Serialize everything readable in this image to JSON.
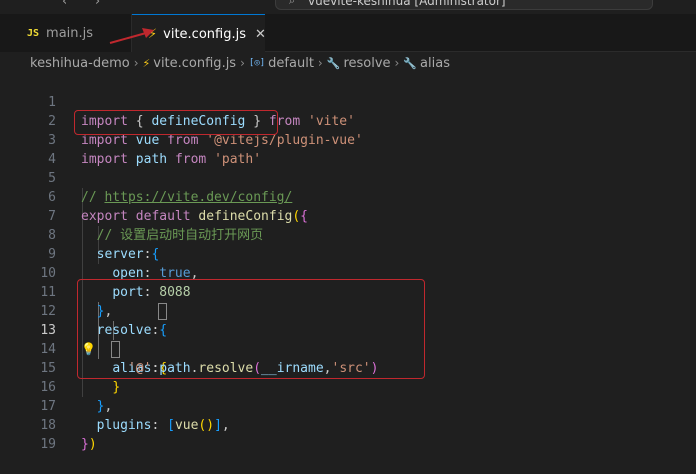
{
  "titlebar": {
    "back_arrow": "‹",
    "forward_arrow": "›",
    "search_glyph": "⌕",
    "window_title": "vuevite-keshihua [Administrator]"
  },
  "tabs": [
    {
      "icon": "JS",
      "label": "main.js"
    },
    {
      "icon": "⚡",
      "label": "vite.config.js",
      "close": "✕"
    }
  ],
  "breadcrumb": {
    "folder": "keshihua-demo",
    "file": "vite.config.js",
    "symbols": [
      "default",
      "resolve",
      "alias"
    ],
    "var_icon": "[◎]",
    "wrench_icon": "🔧",
    "separator": "›"
  },
  "editor": {
    "active_line": 13,
    "bulb_glyph": "💡",
    "lines": [
      {
        "n": "1",
        "tokens": [
          "import",
          " ",
          "{",
          " ",
          "defineConfig",
          " ",
          "}",
          " ",
          "from",
          " ",
          "'vite'"
        ]
      },
      {
        "n": "2",
        "tokens": [
          "import",
          " ",
          "vue",
          " ",
          "from",
          " ",
          "'@vitejs/plugin-vue'"
        ]
      },
      {
        "n": "3",
        "tokens": [
          "import",
          " ",
          "path",
          " ",
          "from",
          " ",
          "'path'"
        ]
      },
      {
        "n": "4",
        "tokens": []
      },
      {
        "n": "5",
        "tokens": [
          "// ",
          "https://vite.dev/config/"
        ]
      },
      {
        "n": "6",
        "tokens": [
          "export",
          " ",
          "default",
          " ",
          "defineConfig",
          "(",
          "{"
        ]
      },
      {
        "n": "7",
        "tokens": [
          "  // 设置启动时自动打开网页"
        ]
      },
      {
        "n": "8",
        "tokens": [
          "  ",
          "server",
          ":",
          "{"
        ]
      },
      {
        "n": "9",
        "tokens": [
          "    ",
          "open",
          ": ",
          "true",
          ","
        ]
      },
      {
        "n": "10",
        "tokens": [
          "    ",
          "port",
          ": ",
          "8088"
        ]
      },
      {
        "n": "11",
        "tokens": [
          "  ",
          "}",
          ","
        ]
      },
      {
        "n": "12",
        "tokens": [
          "  ",
          "resolve",
          ":",
          "{"
        ]
      },
      {
        "n": "13",
        "tokens": [
          "    ",
          "alias",
          ":",
          "{"
        ]
      },
      {
        "n": "14",
        "tokens": [
          "      ",
          "'@'",
          ":",
          "path",
          ".",
          "resolve",
          "(",
          "__irname",
          ",",
          "'src'",
          ")"
        ]
      },
      {
        "n": "15",
        "tokens": [
          "    ",
          "}"
        ]
      },
      {
        "n": "16",
        "tokens": [
          "  ",
          "}",
          ","
        ]
      },
      {
        "n": "17",
        "tokens": [
          "  ",
          "plugins",
          ": ",
          "[",
          "vue",
          "(",
          ")",
          "]",
          ","
        ]
      },
      {
        "n": "18",
        "tokens": [
          "}",
          ")"
        ]
      },
      {
        "n": "19",
        "tokens": []
      }
    ]
  },
  "colors": {
    "annotation_red": "#c0282e",
    "keyword": "#c586c0",
    "string": "#ce9178",
    "comment": "#6a9955"
  }
}
